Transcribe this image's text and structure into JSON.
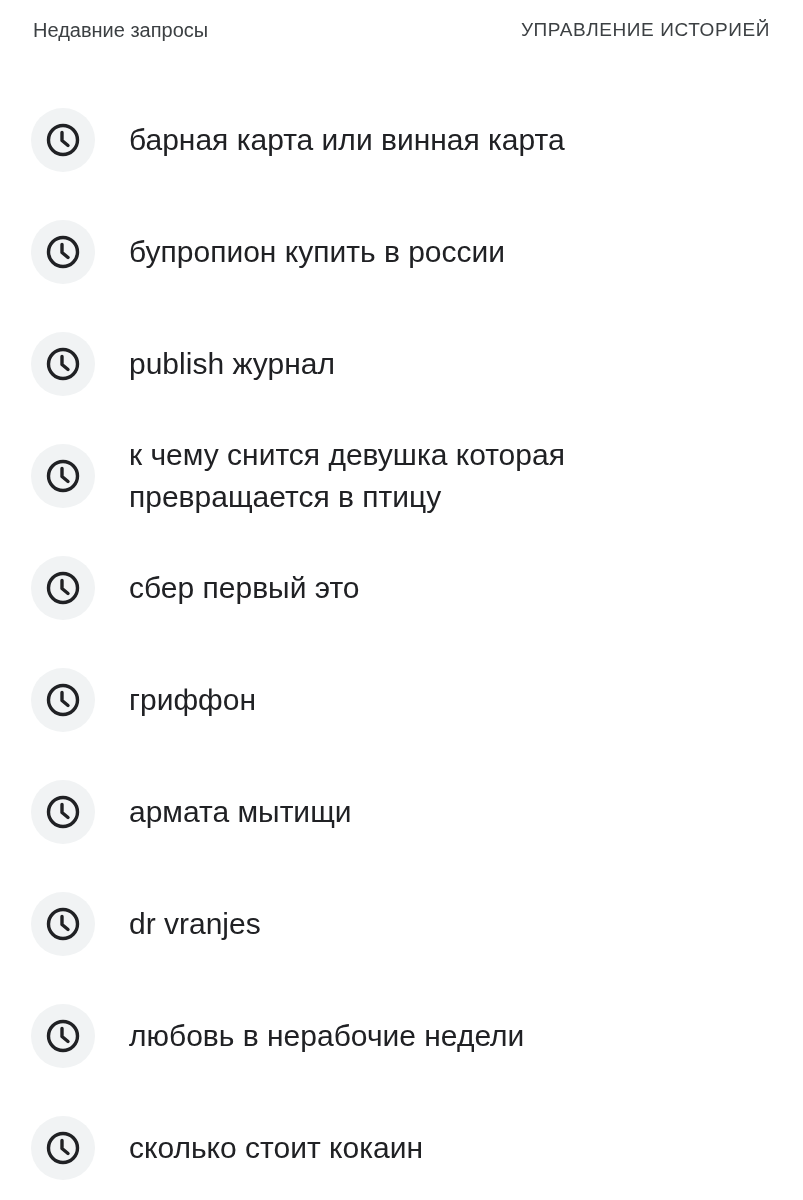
{
  "header": {
    "title": "Недавние запросы",
    "manage_link": "УПРАВЛЕНИЕ ИСТОРИЕЙ"
  },
  "recent_searches": [
    {
      "text": "барная карта или винная карта"
    },
    {
      "text": "бупропион купить в россии"
    },
    {
      "text": "publish журнал"
    },
    {
      "text": "к чему снится девушка которая превращается в птицу"
    },
    {
      "text": "сбер первый это"
    },
    {
      "text": "гриффон"
    },
    {
      "text": "армата мытищи"
    },
    {
      "text": "dr vranjes"
    },
    {
      "text": "любовь в нерабочие недели"
    },
    {
      "text": "сколько стоит кокаин"
    }
  ]
}
